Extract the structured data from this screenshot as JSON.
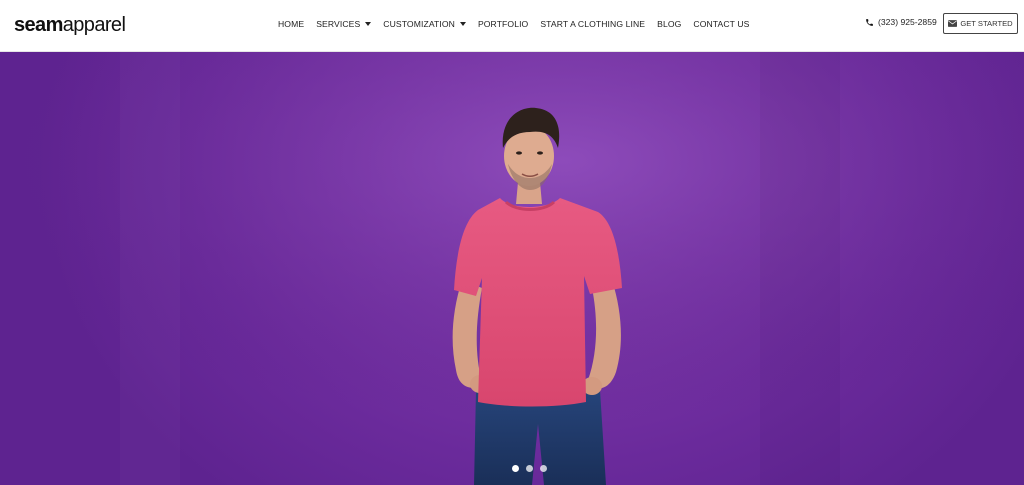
{
  "brand": {
    "logo_bold": "seam",
    "logo_light": "apparel"
  },
  "nav": {
    "home": "HOME",
    "services": "SERVICES",
    "customization": "CUSTOMIZATION",
    "portfolio": "PORTFOLIO",
    "start_line": "START A CLOTHING LINE",
    "blog": "BLOG",
    "contact": "CONTACT US"
  },
  "contact": {
    "phone": "(323) 925-2859"
  },
  "cta": {
    "label": "GET STARTED"
  },
  "hero": {
    "background_color": "#7a36a8",
    "shirt_color": "#e0507a",
    "jeans_color": "#1e3a6b",
    "slides_total": 3,
    "active_slide": 1
  },
  "icons": {
    "phone": "phone-icon",
    "envelope": "envelope-icon",
    "caret": "caret-down-icon"
  }
}
